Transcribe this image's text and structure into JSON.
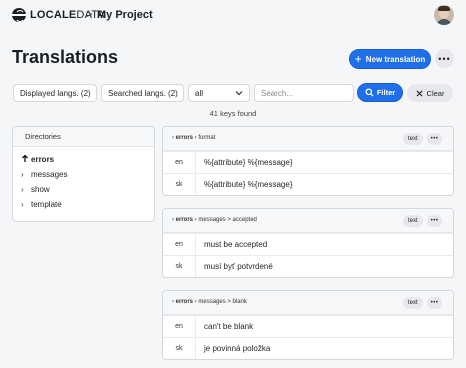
{
  "brand": {
    "bold": "LOCALE",
    "light": "DATA"
  },
  "breadcrumb": {
    "separator": ">",
    "project": "My Project"
  },
  "page": {
    "title": "Translations"
  },
  "actions": {
    "new_translation": "New translation",
    "more": "•••"
  },
  "filters": {
    "displayed_langs": "Displayed langs. (2)",
    "searched_langs": "Searched langs. (2)",
    "scope_selected": "all",
    "search_placeholder": "Search...",
    "filter": "Filter",
    "clear": "Clear"
  },
  "result": {
    "count_text": "41 keys found"
  },
  "directories": {
    "heading": "Directories",
    "items": [
      {
        "label": "errors",
        "icon": "arrow-up-icon",
        "active": true
      },
      {
        "label": "messages",
        "icon": "chevron-right-icon",
        "active": false
      },
      {
        "label": "show",
        "icon": "chevron-right-icon",
        "active": false
      },
      {
        "label": "template",
        "icon": "chevron-right-icon",
        "active": false
      }
    ]
  },
  "translations": [
    {
      "path_bold": "errors",
      "path_rest": "format",
      "type": "text",
      "rows": [
        {
          "lang": "en",
          "text": "%{attribute} %{message}"
        },
        {
          "lang": "sk",
          "text": "%{attribute} %{message}"
        }
      ]
    },
    {
      "path_bold": "errors",
      "path_rest": "messages > accepted",
      "type": "text",
      "rows": [
        {
          "lang": "en",
          "text": "must be accepted"
        },
        {
          "lang": "sk",
          "text": "musí byť potvrdené"
        }
      ]
    },
    {
      "path_bold": "errors",
      "path_rest": "messages > blank",
      "type": "text",
      "rows": [
        {
          "lang": "en",
          "text": "can't be blank"
        },
        {
          "lang": "sk",
          "text": "je povinná položka"
        }
      ]
    }
  ],
  "colors": {
    "accent": "#1f6feb",
    "background": "#f5f6f8"
  }
}
